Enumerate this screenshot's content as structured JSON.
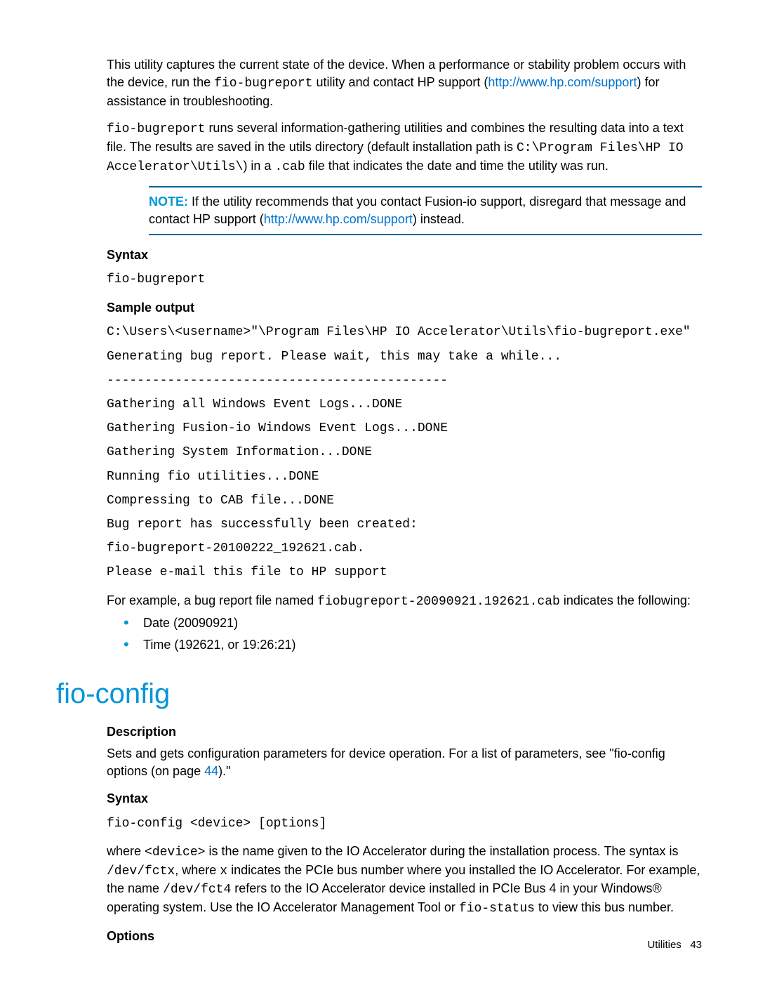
{
  "intro": {
    "p1_a": "This utility captures the current state of the device. When a performance or stability problem occurs with the device, run the ",
    "p1_code": "fio-bugreport",
    "p1_b": " utility and contact HP support (",
    "p1_link": "http://www.hp.com/support",
    "p1_c": ") for assistance in troubleshooting."
  },
  "para2": {
    "a_code": "fio-bugreport",
    "a_txt": " runs several information-gathering utilities and combines the resulting data into a text file. The results are saved in the utils directory (default installation path is ",
    "b_code": "C:\\Program Files\\HP IO Accelerator\\Utils\\",
    "b_txt": ") in a ",
    "c_code": ".cab",
    "c_txt": " file that indicates the date and time the utility was run."
  },
  "note": {
    "label": "NOTE:",
    "a": "  If the utility recommends that you contact Fusion-io support, disregard that message and contact HP support (",
    "link": "http://www.hp.com/support",
    "b": ") instead."
  },
  "syntax1": {
    "heading": "Syntax",
    "code": "fio-bugreport"
  },
  "sample": {
    "heading": "Sample output",
    "lines": "C:\\Users\\<username>\"\\Program Files\\HP IO Accelerator\\Utils\\fio-bugreport.exe\"\nGenerating bug report. Please wait, this may take a while...\n---------------------------------------------\nGathering all Windows Event Logs...DONE\nGathering Fusion-io Windows Event Logs...DONE\nGathering System Information...DONE\nRunning fio utilities...DONE\nCompressing to CAB file...DONE\nBug report has successfully been created:\nfio-bugreport-20100222_192621.cab.\nPlease e-mail this file to HP support"
  },
  "example": {
    "a": "For example, a bug report file named ",
    "code": "fiobugreport-20090921.192621.cab",
    "b": " indicates the following:"
  },
  "bullets": {
    "b1": "Date (20090921)",
    "b2": "Time (192621, or 19:26:21)"
  },
  "section2": {
    "title": "fio-config",
    "desc_heading": "Description",
    "desc_a": "Sets and gets configuration parameters for device operation. For a list of parameters, see \"fio-config options (on page ",
    "desc_pagelink": "44",
    "desc_b": ").\"",
    "syntax_heading": "Syntax",
    "syntax_code": "fio-config <device> [options]",
    "where_a": "where ",
    "where_code1": "<device>",
    "where_b": " is the name given to the IO Accelerator during the installation process. The syntax is ",
    "where_code2": "/dev/fctx",
    "where_c": ", where ",
    "where_code3": "x",
    "where_d": " indicates the PCIe bus number where you installed the IO Accelerator. For example, the name ",
    "where_code4": "/dev/fct4",
    "where_e": " refers to the IO Accelerator device installed in PCIe Bus 4 in your Windows® operating system. Use the IO Accelerator Management Tool or ",
    "where_code5": "fio-status",
    "where_f": " to view this bus number.",
    "options_heading": "Options"
  },
  "footer": {
    "section": "Utilities",
    "page": "43"
  }
}
